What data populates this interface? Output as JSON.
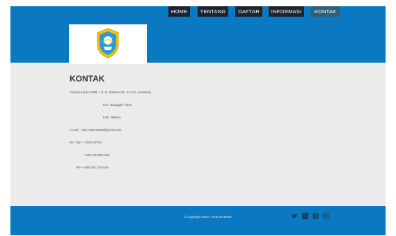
{
  "header": {
    "logo_icon": "tut-wuri-handayani-emblem-icon",
    "nav": [
      {
        "label": "HOME",
        "active": false
      },
      {
        "label": "TENTANG",
        "active": false
      },
      {
        "label": "DAFTAR",
        "active": false
      },
      {
        "label": "INFORMASI",
        "active": false
      },
      {
        "label": "KONTAK",
        "active": true
      }
    ]
  },
  "main": {
    "title": "KONTAK",
    "lines": [
      "Alamat Kantor SKB ~ Jl. H. Saleme No. 24 Kel. Lembang",
      "Kec. Banggae Timur",
      "Kab. Majene",
      "e-mail ~ skb.majene229@gmail.com",
      "No. Telp ~ 0422-22754",
      "~ 085 299 953 454",
      "WA ~ 085 352 745 549"
    ]
  },
  "footer": {
    "copyright": "© copyright 2023 | SKB MAJENE",
    "social_icons": [
      "twitter-icon",
      "facebook-icon",
      "instagram-icon",
      "whatsapp-icon"
    ]
  },
  "colors": {
    "header": "#0b79c1",
    "nav_bg": "#1c2430",
    "nav_active": "#2e5f74",
    "body_bg": "#ebebeb"
  }
}
